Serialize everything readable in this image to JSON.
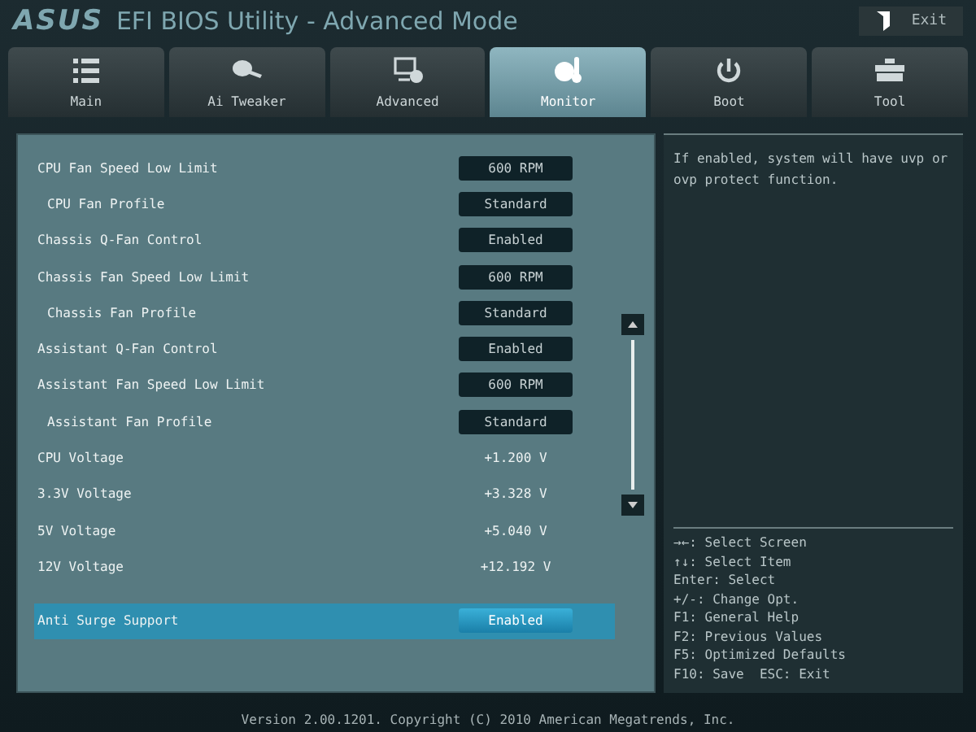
{
  "header": {
    "brand": "ASUS",
    "title": "EFI BIOS Utility - Advanced Mode",
    "exit_button": "Exit"
  },
  "tabs": [
    {
      "label": "Main",
      "selected": false
    },
    {
      "label": "Ai Tweaker",
      "selected": false
    },
    {
      "label": "Advanced",
      "selected": false
    },
    {
      "label": "Monitor",
      "selected": true
    },
    {
      "label": "Boot",
      "selected": false
    },
    {
      "label": "Tool",
      "selected": false
    }
  ],
  "settings": [
    {
      "kind": "option",
      "label": "CPU Fan Speed Low Limit",
      "value": "600 RPM",
      "selected": false,
      "children": [
        {
          "kind": "option",
          "label": "CPU Fan Profile",
          "value": "Standard",
          "selected": false
        }
      ]
    },
    {
      "kind": "option",
      "label": "Chassis Q-Fan Control",
      "value": "Enabled",
      "selected": false
    },
    {
      "kind": "option",
      "label": "Chassis Fan Speed Low Limit",
      "value": "600 RPM",
      "selected": false,
      "children": [
        {
          "kind": "option",
          "label": "Chassis Fan Profile",
          "value": "Standard",
          "selected": false
        }
      ]
    },
    {
      "kind": "option",
      "label": "Assistant Q-Fan Control",
      "value": "Enabled",
      "selected": false
    },
    {
      "kind": "option",
      "label": "Assistant Fan Speed Low Limit",
      "value": "600 RPM",
      "selected": false,
      "children": [
        {
          "kind": "option",
          "label": "Assistant Fan Profile",
          "value": "Standard",
          "selected": false
        }
      ]
    },
    {
      "kind": "reading",
      "label": "CPU Voltage",
      "value": "+1.200 V",
      "selected": false
    },
    {
      "kind": "reading",
      "label": "3.3V Voltage",
      "value": "+3.328 V",
      "selected": false
    },
    {
      "kind": "reading",
      "label": "5V Voltage",
      "value": "+5.040 V",
      "selected": false
    },
    {
      "kind": "reading",
      "label": "12V Voltage",
      "value": "+12.192 V",
      "selected": false
    },
    {
      "kind": "gap"
    },
    {
      "kind": "option",
      "label": "Anti Surge Support",
      "value": "Enabled",
      "selected": true
    }
  ],
  "help": "If enabled, system will have uvp or ovp protect function.",
  "keys": [
    "→←: Select Screen",
    "↑↓: Select Item",
    "Enter: Select",
    "+/-: Change Opt.",
    "F1: General Help",
    "F2: Previous Values",
    "F5: Optimized Defaults",
    "F10: Save  ESC: Exit"
  ],
  "footer": "Version 2.00.1201. Copyright (C) 2010 American Megatrends, Inc."
}
